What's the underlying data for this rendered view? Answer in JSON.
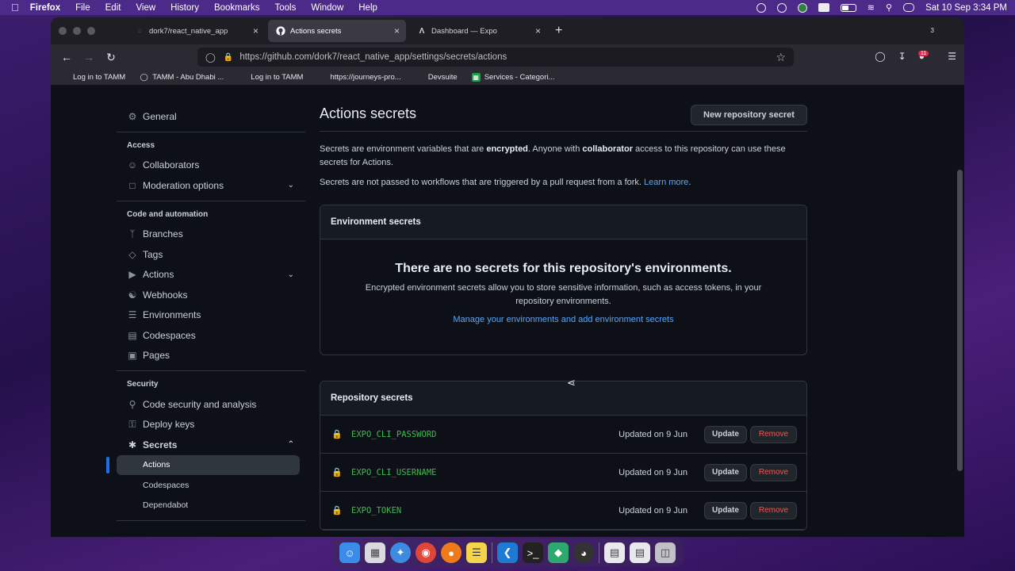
{
  "menubar": {
    "apple": "",
    "app": "Firefox",
    "items": [
      "File",
      "Edit",
      "View",
      "History",
      "Bookmarks",
      "Tools",
      "Window",
      "Help"
    ],
    "datetime": "Sat 10 Sep  3:34 PM"
  },
  "tabs": [
    {
      "title": "dork7/react_native_app",
      "icon": "globe-icon"
    },
    {
      "title": "Actions secrets",
      "icon": "github-icon"
    },
    {
      "title": "Dashboard — Expo",
      "icon": "expo-icon"
    }
  ],
  "tabs_count": "3",
  "url": "https://github.com/dork7/react_native_app/settings/secrets/actions",
  "extension_badge": "11",
  "bookmarks": [
    {
      "label": "Log in to TAMM",
      "icon": "tamm-icon"
    },
    {
      "label": "TAMM - Abu Dhabi ...",
      "icon": "globe-icon"
    },
    {
      "label": "Log in to TAMM",
      "icon": "tamm-icon"
    },
    {
      "label": "https://journeys-pro...",
      "icon": "blank-icon"
    },
    {
      "label": "Devsuite",
      "icon": "blank-icon"
    },
    {
      "label": "Services - Categori...",
      "icon": "sheets-icon"
    }
  ],
  "sidebar": {
    "general": "General",
    "access_heading": "Access",
    "collaborators": "Collaborators",
    "moderation": "Moderation options",
    "code_heading": "Code and automation",
    "branches": "Branches",
    "tags": "Tags",
    "actions": "Actions",
    "webhooks": "Webhooks",
    "environments": "Environments",
    "codespaces": "Codespaces",
    "pages": "Pages",
    "security_heading": "Security",
    "code_security": "Code security and analysis",
    "deploy_keys": "Deploy keys",
    "secrets": "Secrets",
    "secrets_actions": "Actions",
    "secrets_codespaces": "Codespaces",
    "secrets_dependabot": "Dependabot"
  },
  "main": {
    "title": "Actions secrets",
    "new_button": "New repository secret",
    "desc1_a": "Secrets are environment variables that are ",
    "desc1_b": "encrypted",
    "desc1_c": ". Anyone with ",
    "desc1_d": "collaborator",
    "desc1_e": " access to this repository can use these secrets for Actions.",
    "desc2": "Secrets are not passed to workflows that are triggered by a pull request from a fork.",
    "learn_more": "Learn more",
    "env_heading": "Environment secrets",
    "env_empty_title": "There are no secrets for this repository's environments.",
    "env_empty_desc": "Encrypted environment secrets allow you to store sensitive information, such as access tokens, in your repository environments.",
    "env_link": "Manage your environments and add environment secrets",
    "repo_heading": "Repository secrets",
    "secrets": [
      {
        "name": "EXPO_CLI_PASSWORD",
        "updated": "Updated on 9 Jun"
      },
      {
        "name": "EXPO_CLI_USERNAME",
        "updated": "Updated on 9 Jun"
      },
      {
        "name": "EXPO_TOKEN",
        "updated": "Updated on 9 Jun"
      }
    ],
    "update_label": "Update",
    "remove_label": "Remove"
  },
  "colors": {
    "accent": "#58a6ff",
    "secret_green": "#3fb950",
    "danger": "#f85149",
    "bg": "#0d1117"
  }
}
